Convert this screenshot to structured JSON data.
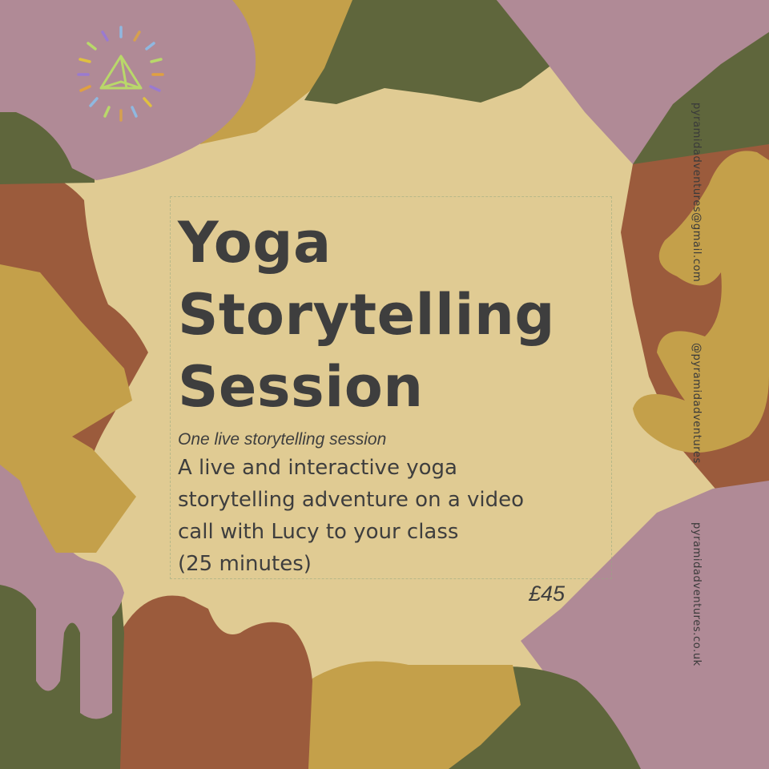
{
  "colors": {
    "cream": "#e0cb93",
    "mauve": "#b08a96",
    "olive": "#5f663c",
    "mustard": "#c4a04a",
    "rust": "#9b5b3c",
    "text": "#3e3e3e"
  },
  "logo": {
    "icon": "pyramid-sunburst-icon"
  },
  "card": {
    "title_lines": [
      "Yoga",
      "Storytelling",
      "Session"
    ],
    "subtitle": "One live storytelling session",
    "description_lines": [
      "A live and interactive yoga",
      "storytelling adventure on a video",
      "call with Lucy to your class",
      "(25 minutes)"
    ],
    "price": "£45"
  },
  "sidebar": {
    "email": "pyramidadventures@gmail.com",
    "handle": "@pyramidadventures",
    "website": "pyramidadventures.co.uk"
  }
}
